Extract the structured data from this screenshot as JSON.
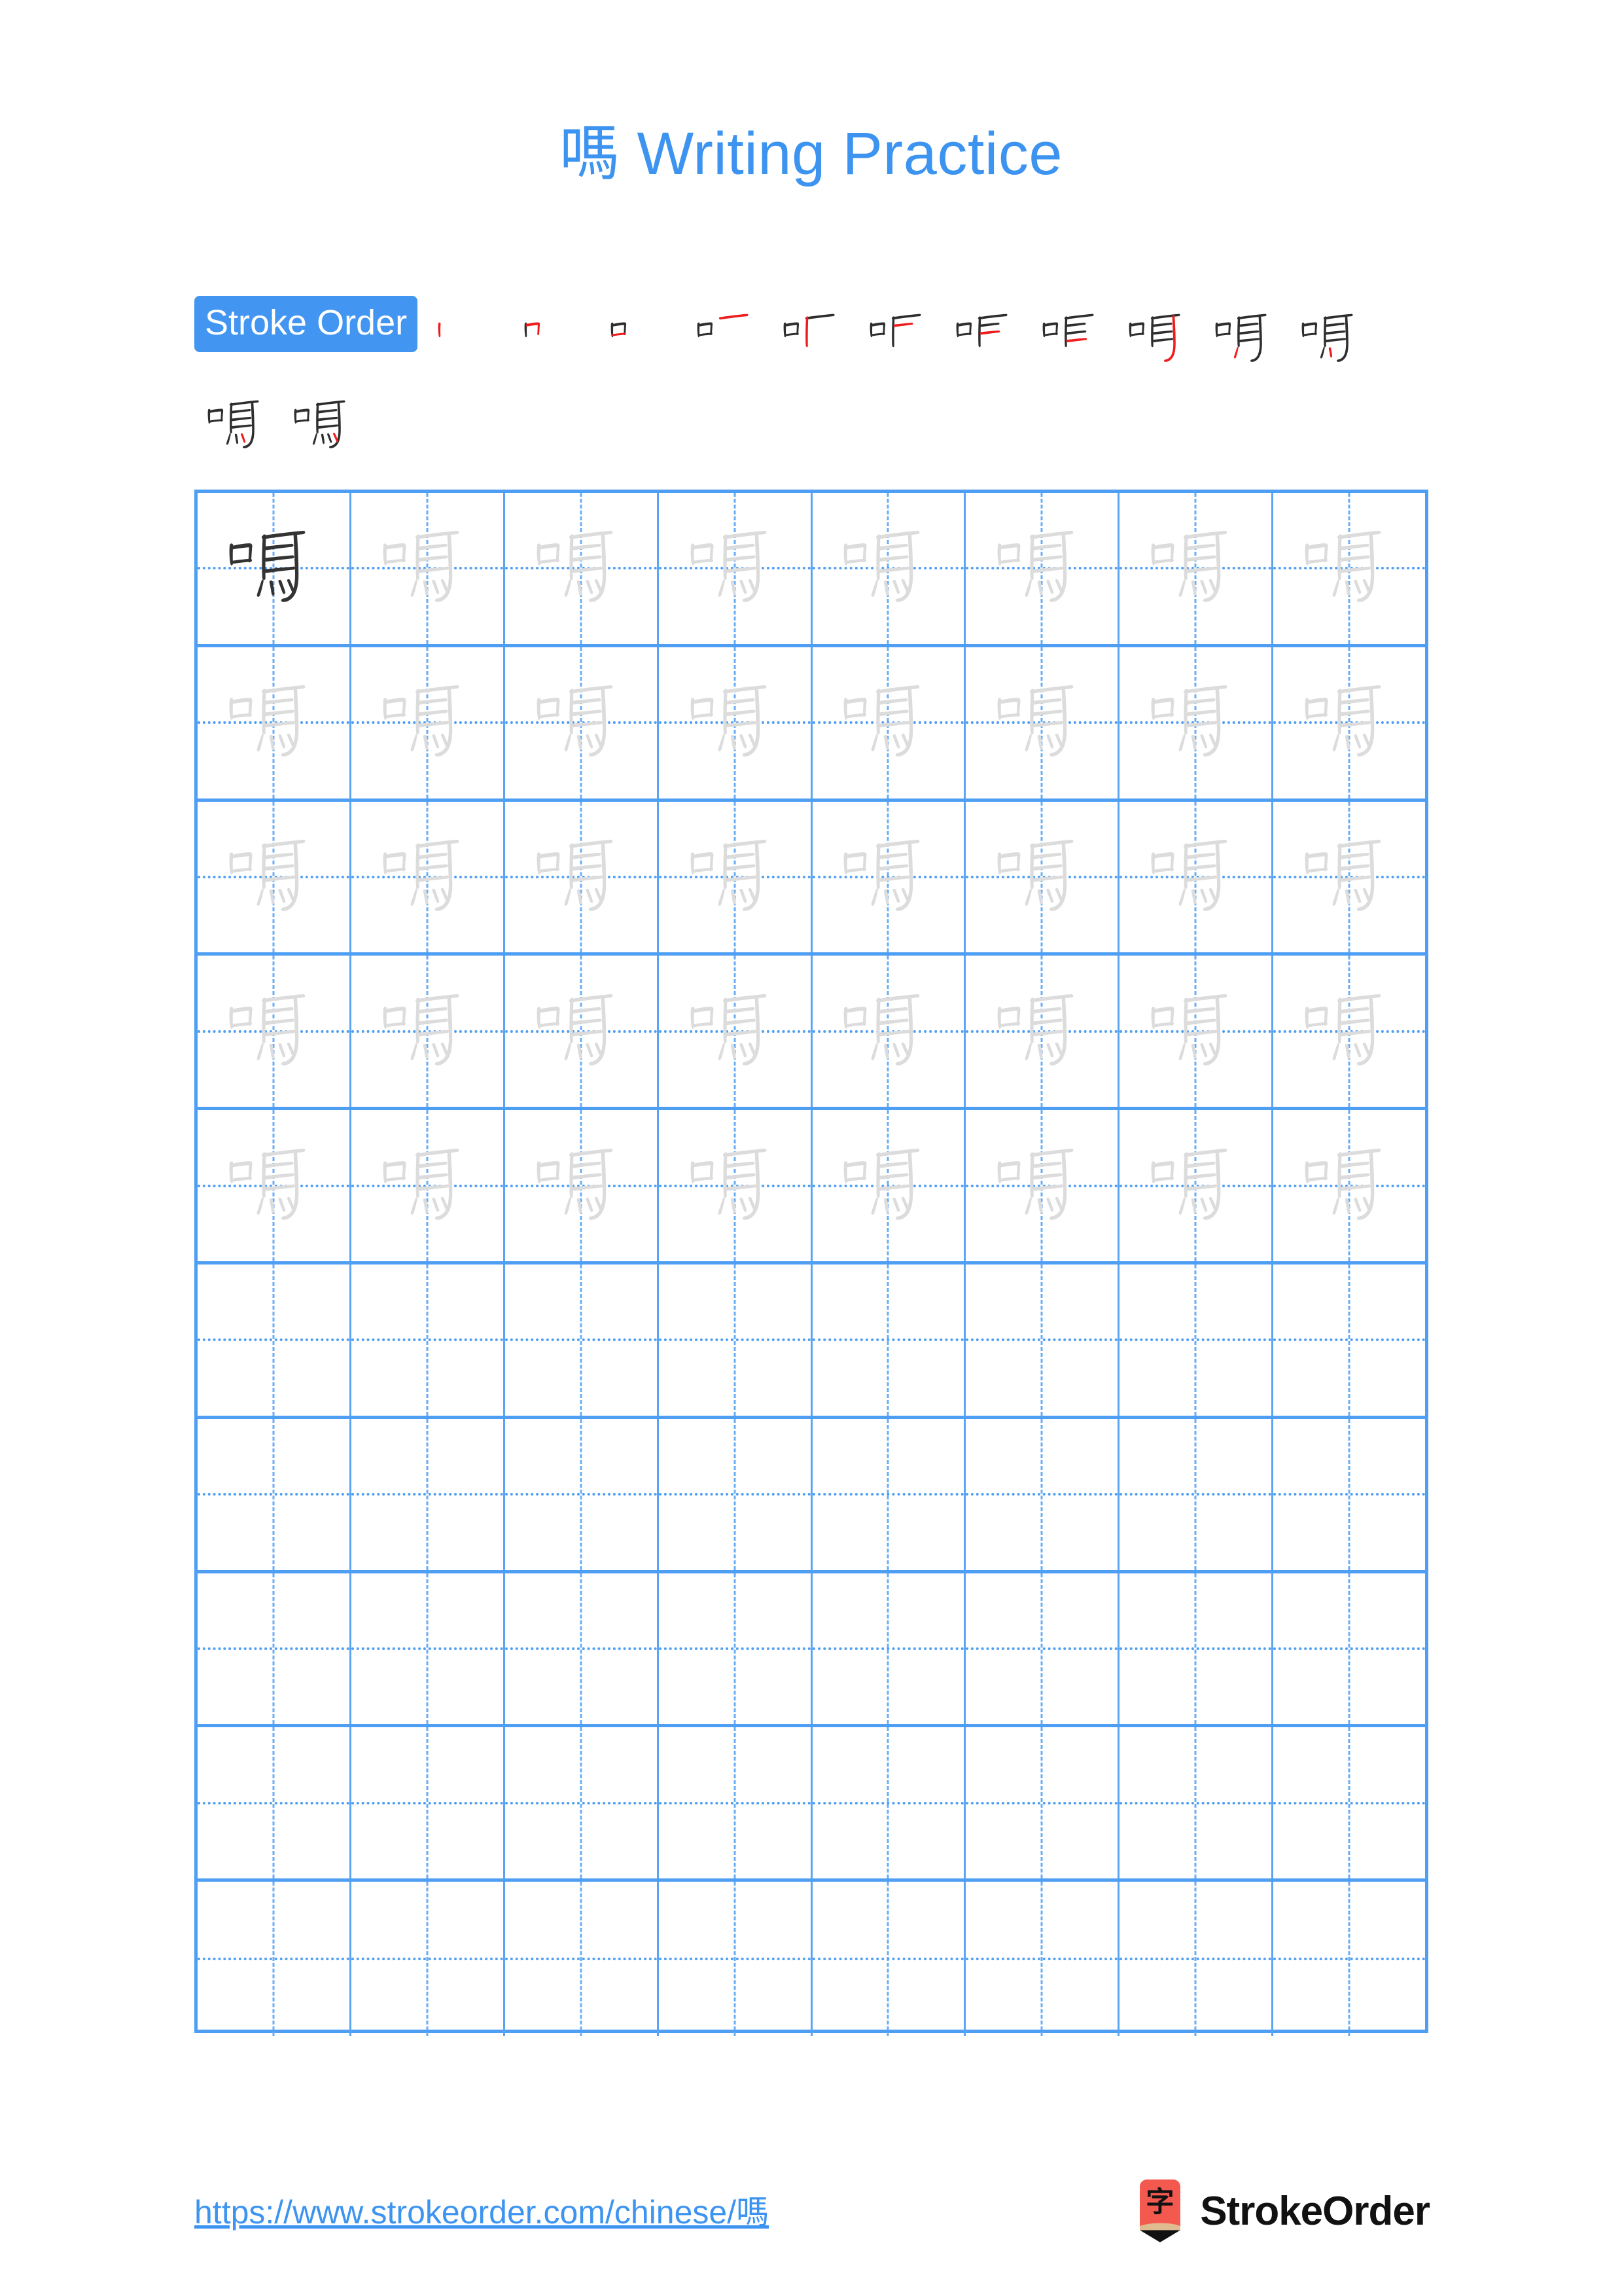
{
  "page": {
    "character": "嗎",
    "title": "嗎 Writing Practice",
    "background_color": "#ffffff",
    "accent_color": "#3d94f0"
  },
  "stroke_order": {
    "badge_label": "Stroke Order",
    "badge_bg_color": "#4295f0",
    "badge_text_color": "#ffffff",
    "total_strokes": 13,
    "completed_stroke_color": "#2e2e2e",
    "new_stroke_color": "#ee1c1c",
    "steps": [
      {
        "index": 1,
        "strokes_shown": 1
      },
      {
        "index": 2,
        "strokes_shown": 2
      },
      {
        "index": 3,
        "strokes_shown": 3
      },
      {
        "index": 4,
        "strokes_shown": 4
      },
      {
        "index": 5,
        "strokes_shown": 5
      },
      {
        "index": 6,
        "strokes_shown": 6
      },
      {
        "index": 7,
        "strokes_shown": 7
      },
      {
        "index": 8,
        "strokes_shown": 8
      },
      {
        "index": 9,
        "strokes_shown": 9
      },
      {
        "index": 10,
        "strokes_shown": 10
      },
      {
        "index": 11,
        "strokes_shown": 11
      },
      {
        "index": 12,
        "strokes_shown": 12
      },
      {
        "index": 13,
        "strokes_shown": 13
      }
    ]
  },
  "practice_grid": {
    "columns": 8,
    "rows": 10,
    "grid_line_color": "#4e9ef4",
    "guide_line_color": "#68aef7",
    "dark_char_color": "#333333",
    "light_char_color": "#dcdcdc",
    "row_fill": [
      [
        "dark",
        "light",
        "light",
        "light",
        "light",
        "light",
        "light",
        "light"
      ],
      [
        "light",
        "light",
        "light",
        "light",
        "light",
        "light",
        "light",
        "light"
      ],
      [
        "light",
        "light",
        "light",
        "light",
        "light",
        "light",
        "light",
        "light"
      ],
      [
        "light",
        "light",
        "light",
        "light",
        "light",
        "light",
        "light",
        "light"
      ],
      [
        "light",
        "light",
        "light",
        "light",
        "light",
        "light",
        "light",
        "light"
      ],
      [
        "empty",
        "empty",
        "empty",
        "empty",
        "empty",
        "empty",
        "empty",
        "empty"
      ],
      [
        "empty",
        "empty",
        "empty",
        "empty",
        "empty",
        "empty",
        "empty",
        "empty"
      ],
      [
        "empty",
        "empty",
        "empty",
        "empty",
        "empty",
        "empty",
        "empty",
        "empty"
      ],
      [
        "empty",
        "empty",
        "empty",
        "empty",
        "empty",
        "empty",
        "empty",
        "empty"
      ],
      [
        "empty",
        "empty",
        "empty",
        "empty",
        "empty",
        "empty",
        "empty",
        "empty"
      ]
    ]
  },
  "footer": {
    "url": "https://www.strokeorder.com/chinese/嗎",
    "url_color": "#3d94f0",
    "brand_name": "StrokeOrder",
    "logo_glyph": "字",
    "logo_body_color": "#f4594f",
    "logo_wood_color": "#dfbb90",
    "logo_tip_color": "#111111"
  }
}
